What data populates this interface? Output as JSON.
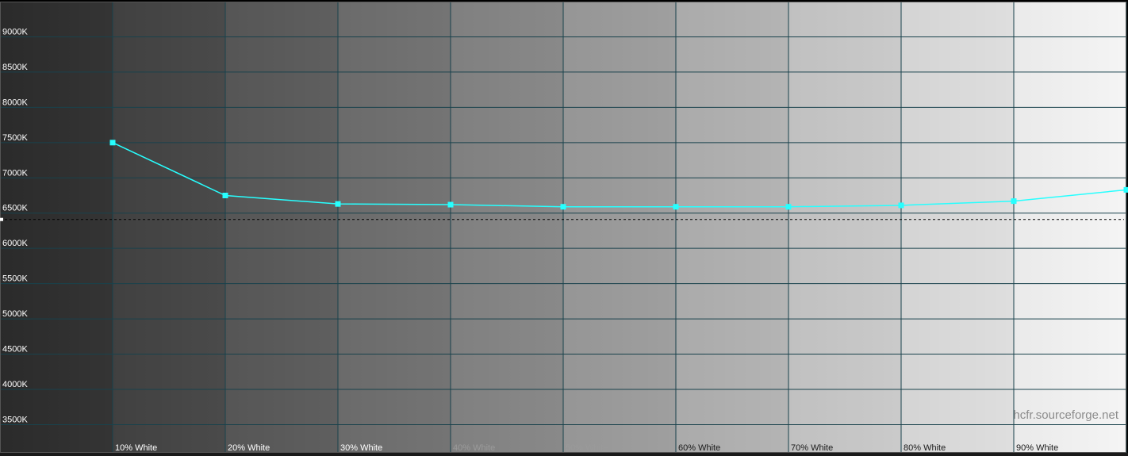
{
  "chart_data": {
    "type": "line",
    "categories": [
      "",
      "10% White",
      "20% White",
      "30% White",
      "40% White",
      "50% White",
      "60% White",
      "70% White",
      "80% White",
      "90% White",
      ""
    ],
    "x": [
      1,
      2,
      3,
      4,
      5,
      6,
      7,
      8,
      9,
      10
    ],
    "series": [
      {
        "values": [
          7500,
          6750,
          6630,
          6620,
          6590,
          6590,
          6590,
          6610,
          6670,
          6830
        ],
        "color": "#27ffff"
      }
    ],
    "reference_value": 6500,
    "reference_style": "dashed",
    "yticks": [
      3500,
      4000,
      4500,
      5000,
      5500,
      6000,
      6500,
      7000,
      7500,
      8000,
      8500,
      9000
    ],
    "ytick_labels": [
      "3500K",
      "4000K",
      "4500K",
      "5000K",
      "5500K",
      "6000K",
      "6500K",
      "7000K",
      "7500K",
      "8000K",
      "8500K",
      "9000K"
    ],
    "ylim": [
      3100,
      9500
    ],
    "xlim": [
      0,
      10
    ],
    "grid": true,
    "grid_color": "#19424c",
    "background": "grayscale-gradient",
    "watermark": "hcfr.sourceforge.net"
  }
}
